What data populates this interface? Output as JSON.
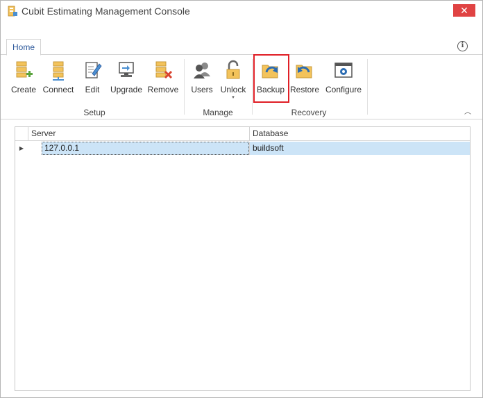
{
  "window": {
    "title": "Cubit Estimating Management Console",
    "close_symbol": "✕"
  },
  "tabs": [
    {
      "label": "Home"
    }
  ],
  "info_symbol": "i",
  "ribbon": {
    "groups": [
      {
        "label": "Setup",
        "buttons": [
          {
            "label": "Create",
            "icon": "create-server-icon"
          },
          {
            "label": "Connect",
            "icon": "connect-server-icon"
          },
          {
            "label": "Edit",
            "icon": "edit-document-icon"
          },
          {
            "label": "Upgrade",
            "icon": "upgrade-monitor-icon"
          },
          {
            "label": "Remove",
            "icon": "remove-server-icon"
          }
        ]
      },
      {
        "label": "Manage",
        "buttons": [
          {
            "label": "Users",
            "icon": "users-icon"
          },
          {
            "label": "Unlock",
            "icon": "unlock-padlock-icon",
            "dropdown": "▾"
          }
        ]
      },
      {
        "label": "Recovery",
        "buttons": [
          {
            "label": "Backup",
            "icon": "backup-folder-icon"
          },
          {
            "label": "Restore",
            "icon": "restore-folder-icon"
          },
          {
            "label": "Configure",
            "icon": "configure-window-icon"
          }
        ]
      }
    ],
    "collapse_symbol": "︿"
  },
  "grid": {
    "columns": [
      "Server",
      "Database"
    ],
    "rows": [
      {
        "indicator": "▶",
        "server": "127.0.0.1",
        "database": "buildsoft"
      }
    ]
  },
  "colors": {
    "accent": "#2b579a",
    "highlight": "#e01f26",
    "selection": "#cce4f7",
    "close": "#e04343"
  }
}
